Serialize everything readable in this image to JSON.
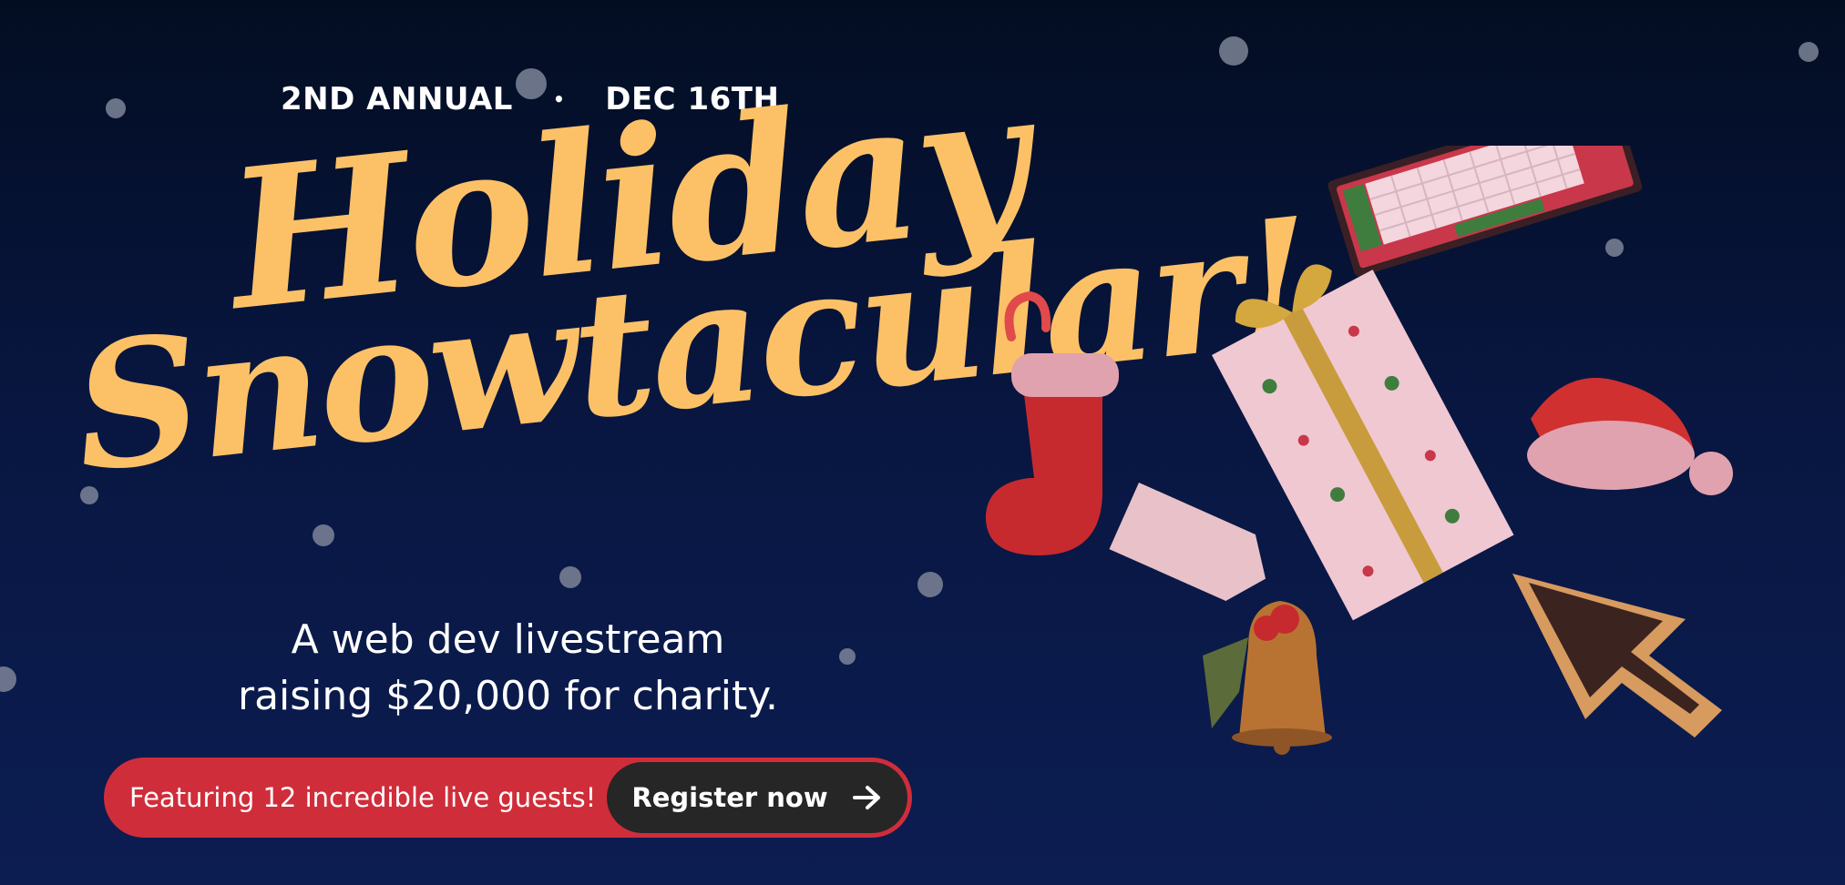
{
  "event": {
    "edition": "2ND ANNUAL",
    "separator": "•",
    "date": "DEC 16TH"
  },
  "headline": {
    "line1": "Holiday",
    "line2": "Snowtacular!"
  },
  "subtitle": {
    "line1": "A web dev livestream",
    "line2": "raising $20,000 for charity."
  },
  "cta": {
    "featuring": "Featuring 12 incredible live guests!",
    "register_label": "Register now",
    "icon": "arrow-right-icon"
  },
  "colors": {
    "background": "#081640",
    "headline": "#fcc167",
    "cta_bar": "#d02d3a",
    "button": "#262626"
  }
}
